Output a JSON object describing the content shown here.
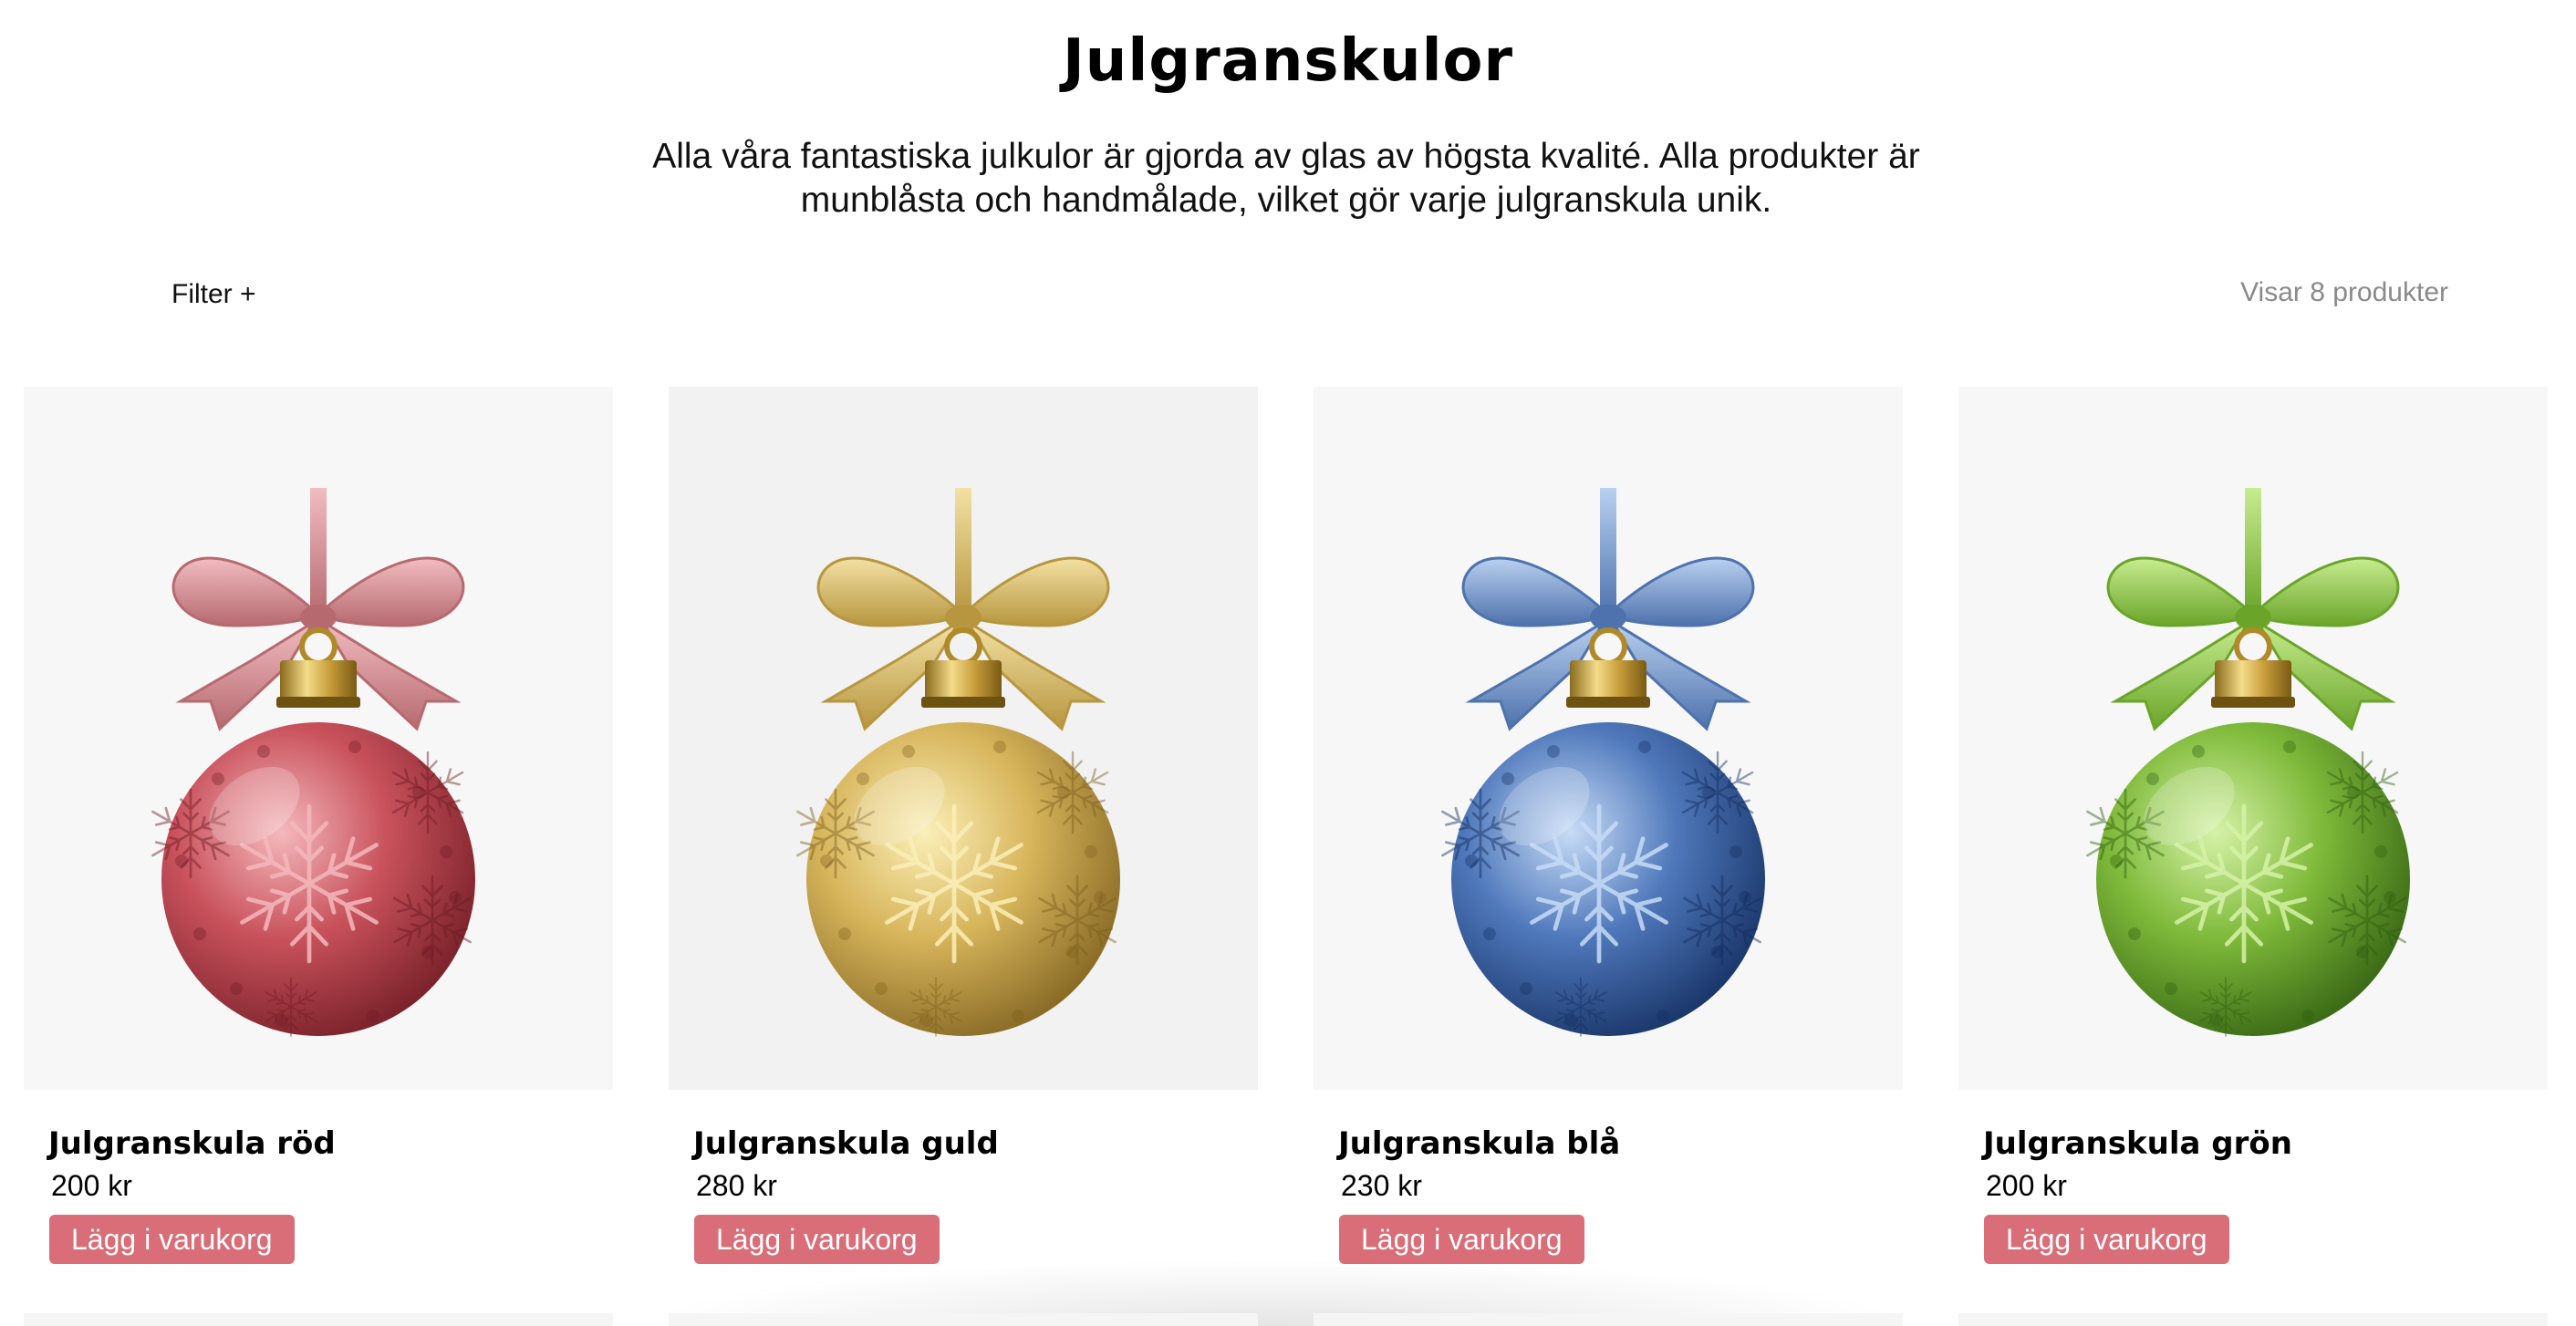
{
  "page": {
    "title": "Julgranskulor",
    "intro": "Alla våra fantastiska julkulor är gjorda av glas av högsta kvalité. Alla produkter är munblåsta och handmålade, vilket gör varje julgranskula unik."
  },
  "toolbar": {
    "filter_label": "Filter +",
    "count_text": "Visar 8 produkter"
  },
  "products": [
    {
      "name": "Julgranskula röd",
      "price": "200 kr",
      "button_label": "Lägg i varukorg",
      "image": "red-ornament-icon",
      "colors": {
        "light": "#f4b9bd",
        "mid": "#c9525c",
        "dark": "#6e1a22",
        "bow_light": "#f1bcc0",
        "bow_dark": "#b66a70"
      }
    },
    {
      "name": "Julgranskula guld",
      "price": "280 kr",
      "button_label": "Lägg i varukorg",
      "image": "gold-ornament-icon",
      "colors": {
        "light": "#fbefb8",
        "mid": "#d7b55b",
        "dark": "#7d5f1e",
        "bow_light": "#f3e1a3",
        "bow_dark": "#b7963f"
      }
    },
    {
      "name": "Julgranskula blå",
      "price": "230 kr",
      "button_label": "Lägg i varukorg",
      "image": "blue-ornament-icon",
      "colors": {
        "light": "#c7dcf6",
        "mid": "#4f78bb",
        "dark": "#122c5e",
        "bow_light": "#b9d0ef",
        "bow_dark": "#4e72ad"
      }
    },
    {
      "name": "Julgranskula grön",
      "price": "200 kr",
      "button_label": "Lägg i varukorg",
      "image": "green-ornament-icon",
      "colors": {
        "light": "#d6f2a8",
        "mid": "#7fba3a",
        "dark": "#2f5d10",
        "bow_light": "#c7ec8f",
        "bow_dark": "#6aa52a"
      }
    }
  ]
}
